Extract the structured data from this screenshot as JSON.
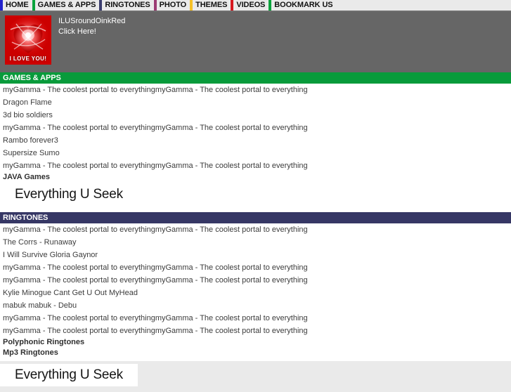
{
  "nav": {
    "items": [
      {
        "label": "HOME",
        "accent": "#2222cc"
      },
      {
        "label": "GAMES & APPS",
        "accent": "#0aa33c"
      },
      {
        "label": "RINGTONES",
        "accent": "#3a3c6e"
      },
      {
        "label": "PHOTO",
        "accent": "#9c3b73"
      },
      {
        "label": "THEMES",
        "accent": "#f5c026"
      },
      {
        "label": "VIDEOS",
        "accent": "#d71920"
      },
      {
        "label": "BOOKMARK US",
        "accent": "#0aa33c"
      }
    ]
  },
  "banner": {
    "image_caption": "I LOVE YOU!",
    "title": "ILUSroundOinkRed",
    "subtitle": "Click Here!",
    "background_color": "#666666",
    "image_color": "#cc0000"
  },
  "sections": [
    {
      "header": "GAMES & APPS",
      "header_color": "#089b3b",
      "items": [
        "myGamma - The coolest portal to everythingmyGamma - The coolest portal to everything",
        "Dragon Flame",
        "3d bio soldiers",
        "myGamma - The coolest portal to everythingmyGamma - The coolest portal to everything",
        "Rambo forever3",
        "Supersize Sumo",
        "myGamma - The coolest portal to everythingmyGamma - The coolest portal to everything"
      ],
      "sub_labels": [
        "JAVA Games"
      ],
      "ad_banner": "Everything U Seek"
    },
    {
      "header": "RINGTONES",
      "header_color": "#363765",
      "items": [
        "myGamma - The coolest portal to everythingmyGamma - The coolest portal to everything",
        "The Corrs - Runaway",
        "I Will Survive Gloria Gaynor",
        "myGamma - The coolest portal to everythingmyGamma - The coolest portal to everything",
        "myGamma - The coolest portal to everythingmyGamma - The coolest portal to everything",
        "Kylie Minogue Cant Get U Out MyHead",
        "mabuk mabuk - Debu",
        "myGamma - The coolest portal to everythingmyGamma - The coolest portal to everything",
        "myGamma - The coolest portal to everythingmyGamma - The coolest portal to everything"
      ],
      "sub_labels": [
        "Polyphonic Ringtones",
        "Mp3 Ringtones"
      ],
      "ad_banner": "Everything U Seek"
    }
  ]
}
